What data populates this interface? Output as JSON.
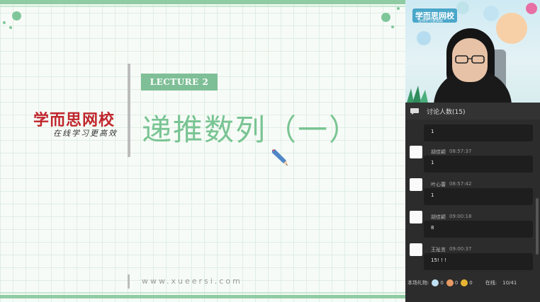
{
  "slide": {
    "lecture_label": "LECTURE 2",
    "title": "递推数列（一）",
    "logo_text": "学而思网校",
    "logo_tagline": "在线学习更高效",
    "website": "www.xueersi.com",
    "accent_color": "#7fbf97",
    "logo_color": "#c0262d"
  },
  "video": {
    "logo_text": "学而思网校",
    "logo_sub": "在线学习更高效"
  },
  "chat": {
    "header": "讨论人数(15)",
    "messages": [
      {
        "name": "",
        "time": "",
        "text": "1"
      },
      {
        "name": "胡佳颖",
        "time": "08:57:37",
        "text": "1"
      },
      {
        "name": "叶心蕾",
        "time": "08:57:42",
        "text": "1"
      },
      {
        "name": "胡佳颖",
        "time": "09:00:18",
        "text": "8"
      },
      {
        "name": "王祉言",
        "time": "09:00:37",
        "text": "15! ! !"
      }
    ]
  },
  "footer": {
    "gifts_label": "本场礼物:",
    "gift1_count": "0",
    "gift2_count": "0",
    "gift3_count": "0",
    "online_label": "在线:",
    "online_value": "10/41"
  }
}
